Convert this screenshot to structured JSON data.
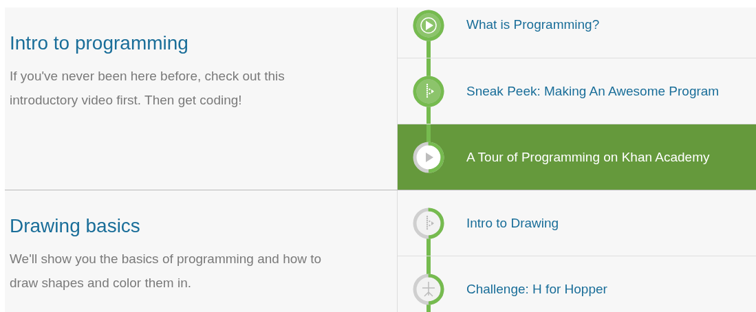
{
  "sections": [
    {
      "title": "Intro to programming",
      "description": "If you've never been here before, check out this introductory video first. Then get coding!",
      "items": [
        {
          "title": "What is Programming?",
          "kind": "video",
          "complete": true,
          "selected": false
        },
        {
          "title": "Sneak Peek: Making An Awesome Program",
          "kind": "talkthrough",
          "complete": true,
          "selected": false
        },
        {
          "title": "A Tour of Programming on Khan Academy",
          "kind": "video",
          "complete": false,
          "selected": true
        }
      ]
    },
    {
      "title": "Drawing basics",
      "description": "We'll show you the basics of programming and how to draw shapes and color them in.",
      "items": [
        {
          "title": "Intro to Drawing",
          "kind": "talkthrough",
          "complete": false,
          "selected": false
        },
        {
          "title": "Challenge: H for Hopper",
          "kind": "challenge",
          "complete": false,
          "selected": false
        }
      ]
    }
  ]
}
